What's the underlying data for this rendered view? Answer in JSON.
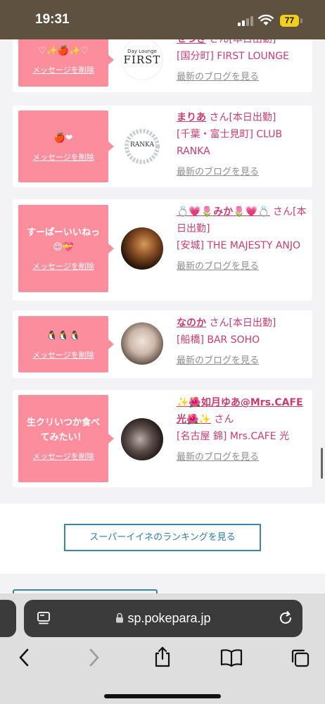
{
  "status_bar": {
    "time": "19:31",
    "battery": "77"
  },
  "cards": [
    {
      "message": "♡✨🍎✨♡",
      "delete_label": "メッセージを削除",
      "name": "せつき",
      "honorific": "さん",
      "status": "[本日出勤]",
      "shop": "[国分町] FIRST LOUNGE",
      "avatar_text": "FIRST",
      "avatar_sub": "Day Lounge",
      "blog_link": "最新のブログを見る"
    },
    {
      "message": "🍎❤",
      "delete_label": "メッセージを削除",
      "name": "まりあ",
      "honorific": "さん",
      "status": "[本日出勤]",
      "shop": "[千葉・富士見町] CLUB RANKA",
      "avatar_text": "RANKA",
      "blog_link": "最新のブログを見る"
    },
    {
      "message": "すーぱーいいねっ😊💝",
      "delete_label": "メッセージを削除",
      "name": "💍💗🌷みか🌷💗💍",
      "honorific": "さん",
      "status": "[本日出勤]",
      "shop": "[安城] THE MAJESTY ANJO",
      "blog_link": "最新のブログを見る"
    },
    {
      "message": "🐧🐧🐧",
      "delete_label": "メッセージを削除",
      "name": "なのか",
      "honorific": "さん",
      "status": "[本日出勤]",
      "shop": "[船橋] BAR SOHO",
      "blog_link": "最新のブログを見る"
    },
    {
      "message": "生クリいつか食べてみたい！",
      "delete_label": "メッセージを削除",
      "name": "✨🌺如月ゆあ@Mrs.CAFE光🌺✨",
      "honorific": "さん",
      "status": "",
      "shop": "[名古屋 錦] Mrs.CAFE 光",
      "blog_link": "最新のブログを見る"
    }
  ],
  "ranking_button": "スーパーイイネのランキングを見る",
  "browser": {
    "url": "sp.pokepara.jp"
  },
  "colors": {
    "bubble": "#fc8d9d",
    "link": "#cc3c6d",
    "button_border": "#3c84a8"
  }
}
